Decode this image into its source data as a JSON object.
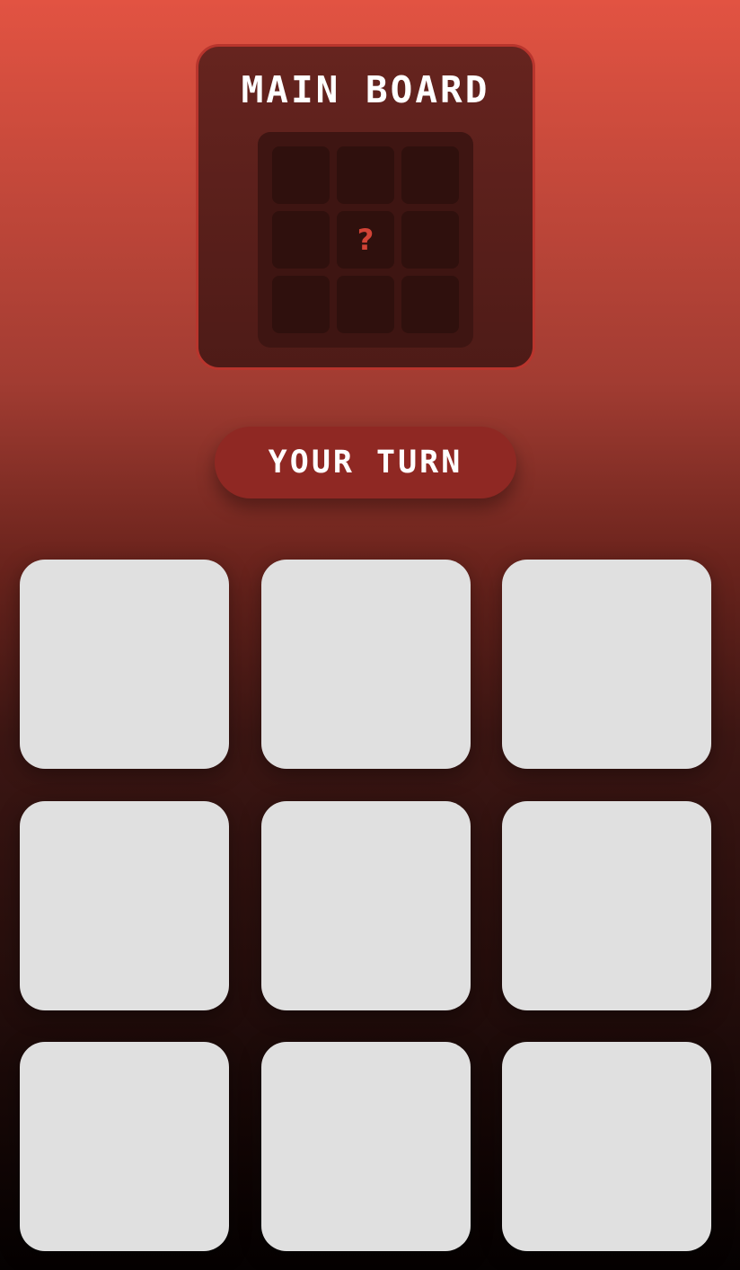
{
  "main_board": {
    "title": "MAIN BOARD",
    "cells": [
      "",
      "",
      "",
      "",
      "?",
      "",
      "",
      "",
      ""
    ]
  },
  "turn_indicator": {
    "label": "YOUR TURN"
  },
  "play_board": {
    "cells": [
      "",
      "",
      "",
      "",
      "",
      "",
      "",
      "",
      ""
    ]
  },
  "colors": {
    "accent": "#d24336",
    "pill": "#8f2823",
    "cell": "#e0e0e0",
    "board_border": "#b8352d"
  }
}
